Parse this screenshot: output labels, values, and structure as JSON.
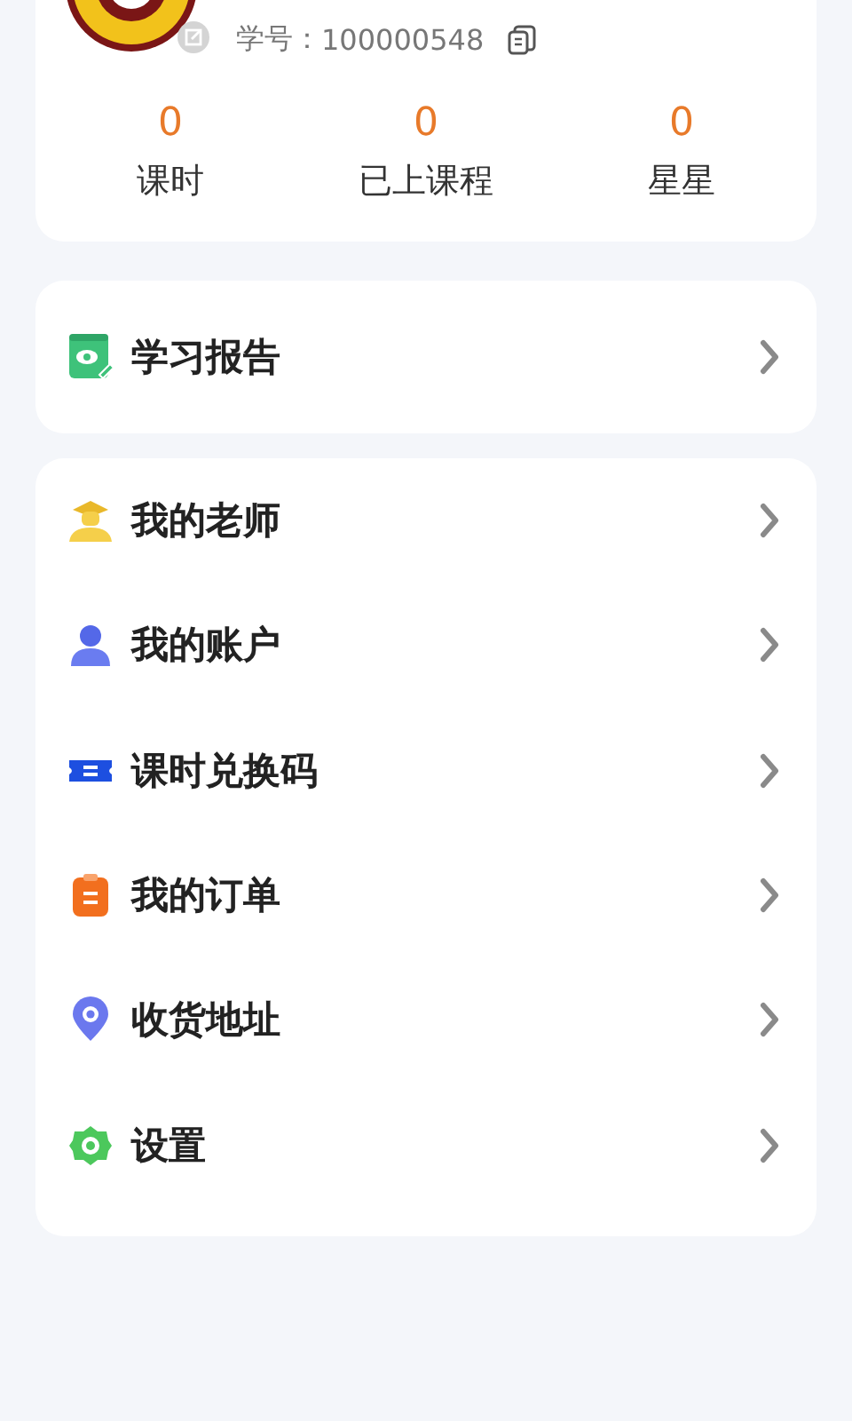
{
  "profile": {
    "student_id_label": "学号：",
    "student_id": "100000548"
  },
  "stats": [
    {
      "value": "0",
      "label": "课时"
    },
    {
      "value": "0",
      "label": "已上课程"
    },
    {
      "value": "0",
      "label": "星星"
    }
  ],
  "report": {
    "label": "学习报告"
  },
  "menu": [
    {
      "label": "我的老师",
      "kind": "teacher"
    },
    {
      "label": "我的账户",
      "kind": "account"
    },
    {
      "label": "课时兑换码",
      "kind": "ticket"
    },
    {
      "label": "我的订单",
      "kind": "order"
    },
    {
      "label": "收货地址",
      "kind": "location"
    },
    {
      "label": "设置",
      "kind": "settings"
    }
  ]
}
